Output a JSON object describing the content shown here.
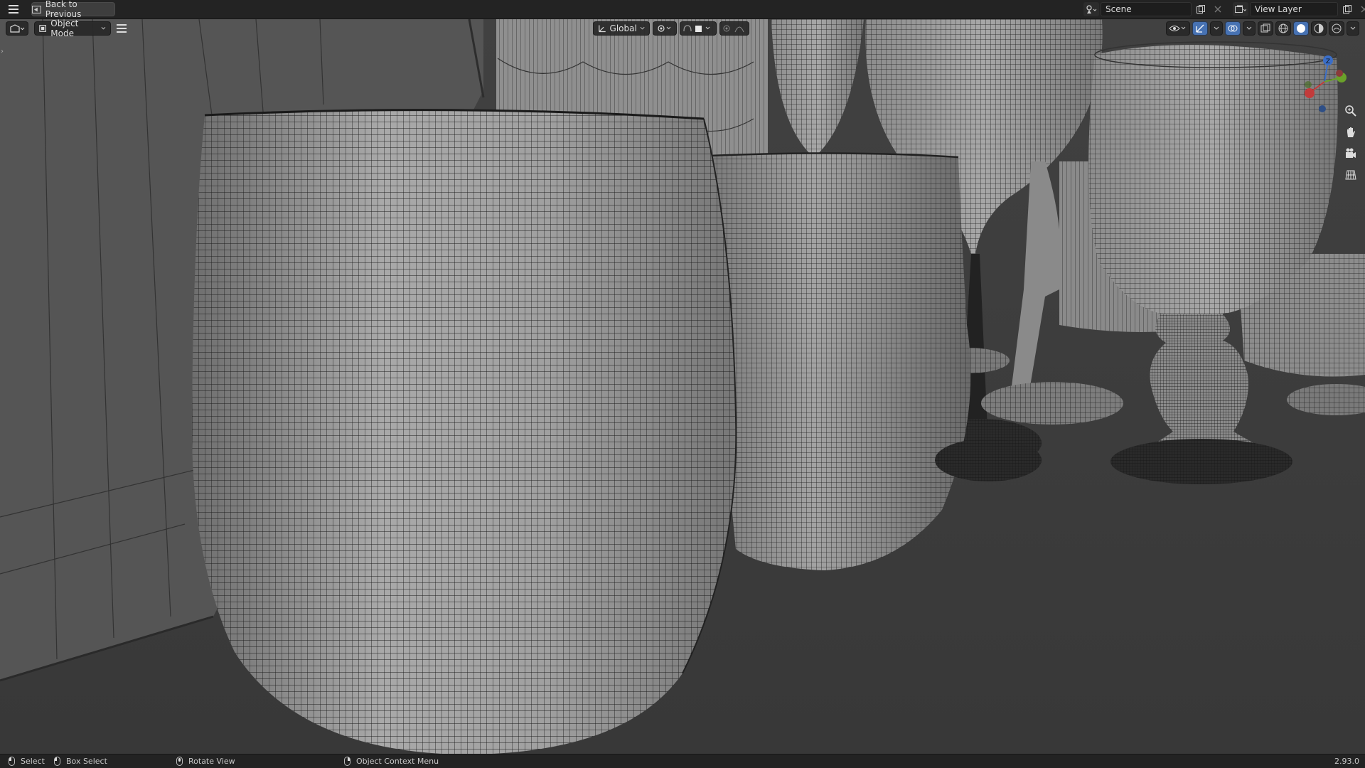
{
  "topbar": {
    "back_label": "Back to Previous",
    "scene_name": "Scene",
    "view_layer_name": "View Layer"
  },
  "viewport_header": {
    "mode_label": "Object Mode",
    "orientation_label": "Global"
  },
  "statusbar": {
    "select_label": "Select",
    "box_select_label": "Box Select",
    "rotate_label": "Rotate View",
    "context_menu_label": "Object Context Menu",
    "version": "2.93.0"
  },
  "gizmo": {
    "axes": [
      "Z",
      "Y",
      "X"
    ],
    "colors": {
      "x": "#c23b3b",
      "y": "#6aa12a",
      "z": "#3a6ec8"
    }
  },
  "icons": [
    "menu-icon",
    "back-icon",
    "scene-icon",
    "view-layer-icon",
    "object-mode-icon",
    "transform-icon",
    "pivot-icon",
    "snap-icon",
    "proportional-icon",
    "visibility-icon",
    "gizmo-icon",
    "overlay-icon",
    "xray-icon",
    "wireframe-icon",
    "solid-icon",
    "material-icon",
    "rendered-icon",
    "zoom-icon",
    "hand-icon",
    "camera-icon",
    "grid-icon"
  ],
  "colors": {
    "topbar": "#232323",
    "viewport_bg": "#3d3d3d",
    "accent_blue": "#4772b3",
    "mesh_light": "#b8b8b8",
    "mesh_dark": "#5a5a5a"
  }
}
